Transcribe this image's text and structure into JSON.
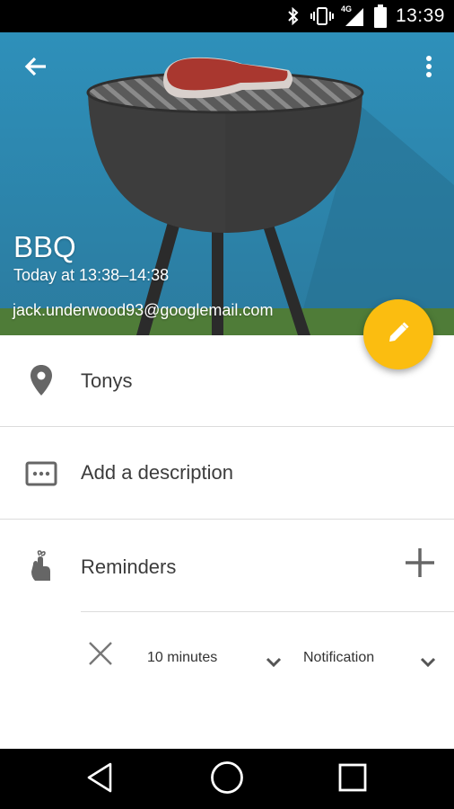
{
  "status_bar": {
    "time": "13:39",
    "network_label": "4G",
    "icons": [
      "bluetooth-icon",
      "vibrate-icon",
      "signal-icon",
      "battery-icon"
    ]
  },
  "event": {
    "title": "BBQ",
    "time_range": "Today at 13:38–14:38",
    "account": "jack.underwood93@googlemail.com",
    "header_color": "#2f8fb6",
    "fab_color": "#fbbd10"
  },
  "details": {
    "location": "Tonys",
    "description_placeholder": "Add a description",
    "reminders_label": "Reminders"
  },
  "reminder": {
    "time": "10 minutes",
    "method": "Notification"
  },
  "nav_bar": {
    "icons": [
      "back-nav-icon",
      "home-nav-icon",
      "recents-nav-icon"
    ]
  }
}
